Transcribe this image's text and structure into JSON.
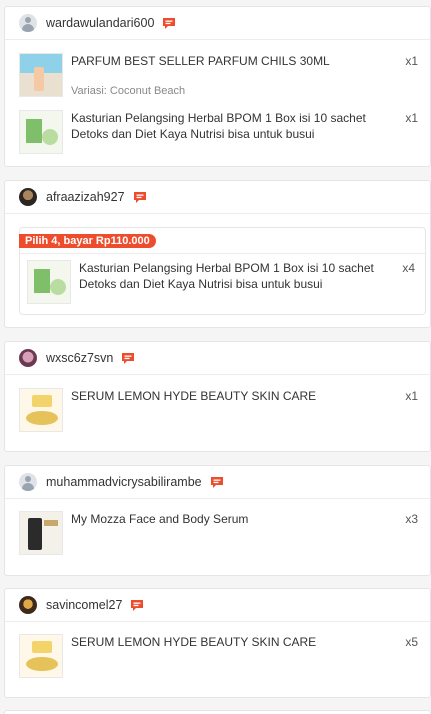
{
  "colors": {
    "accent": "#ee4d2d",
    "chat_icon": "#ee4d2d"
  },
  "orders": [
    {
      "username": "wardawulandari600",
      "avatar": "default-avatar-icon",
      "items": [
        {
          "title": "PARFUM BEST SELLER PARFUM CHILS 30ML",
          "qty": "x1",
          "variant": "Variasi: Coconut Beach"
        },
        {
          "title": "Kasturian Pelangsing Herbal BPOM 1 Box isi 10 sachet Detoks dan Diet Kaya Nutrisi bisa untuk busui",
          "qty": "x1"
        }
      ]
    },
    {
      "username": "afraazizah927",
      "avatar": "user-photo",
      "bundle_badge": "Pilih 4, bayar Rp110.000",
      "items": [
        {
          "title": "Kasturian Pelangsing Herbal BPOM 1 Box isi 10 sachet Detoks dan Diet Kaya Nutrisi bisa untuk busui",
          "qty": "x4"
        }
      ]
    },
    {
      "username": "wxsc6z7svn",
      "avatar": "user-photo",
      "items": [
        {
          "title": "SERUM LEMON HYDE BEAUTY SKIN CARE",
          "qty": "x1"
        }
      ]
    },
    {
      "username": "muhammadvicrysabilirambe",
      "avatar": "default-avatar-icon",
      "items": [
        {
          "title": "My Mozza Face and Body Serum",
          "qty": "x3"
        }
      ]
    },
    {
      "username": "savincomel27",
      "avatar": "user-photo",
      "items": [
        {
          "title": "SERUM LEMON HYDE BEAUTY SKIN CARE",
          "qty": "x5"
        }
      ]
    }
  ]
}
